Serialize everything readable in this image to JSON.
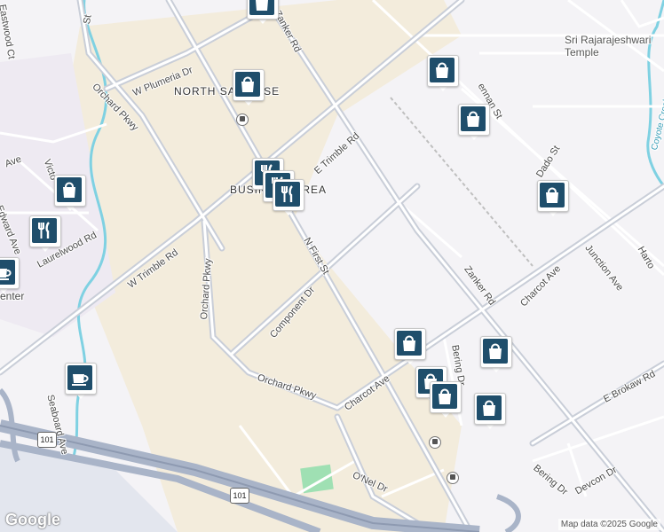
{
  "map": {
    "area_labels": [
      {
        "id": "north-san-jose",
        "text": "NORTH SAN JOSE"
      },
      {
        "id": "business-area",
        "text": "BUSINESS AREA"
      },
      {
        "id": "center",
        "text": "enter"
      }
    ],
    "street_labels": [
      {
        "id": "zanker-rd-north",
        "text": "Zanker Rd"
      },
      {
        "id": "w-plumeria-dr",
        "text": "W Plumeria Dr"
      },
      {
        "id": "orchard-pkwy-north",
        "text": "Orchard Pkwy"
      },
      {
        "id": "orchard-pkwy-west",
        "text": "Orchard Pkwy"
      },
      {
        "id": "e-trimble-rd",
        "text": "E Trimble Rd"
      },
      {
        "id": "w-trimble-rd",
        "text": "W Trimble Rd"
      },
      {
        "id": "n-first-st",
        "text": "N First St"
      },
      {
        "id": "component-dr",
        "text": "Component Dr"
      },
      {
        "id": "orchard-pkwy-south-v",
        "text": "Orchard Pkwy"
      },
      {
        "id": "orchard-pkwy-south",
        "text": "Orchard Pkwy"
      },
      {
        "id": "charcot-ave-sw",
        "text": "Charcot Ave"
      },
      {
        "id": "charcot-ave-ne",
        "text": "Charcot Ave"
      },
      {
        "id": "zanker-rd-south",
        "text": "Zanker Rd"
      },
      {
        "id": "junction-ave",
        "text": "Junction Ave"
      },
      {
        "id": "e-brokaw-rd",
        "text": "E Brokaw Rd"
      },
      {
        "id": "dado-st",
        "text": "Dado St"
      },
      {
        "id": "bering-dr-north",
        "text": "Bering Dr"
      },
      {
        "id": "bering-dr-south",
        "text": "Bering Dr"
      },
      {
        "id": "devcon-dr",
        "text": "Devcon Dr"
      },
      {
        "id": "onel-dr",
        "text": "O'Nel Dr"
      },
      {
        "id": "seaboard-ave",
        "text": "Seaboard Ave"
      },
      {
        "id": "laurelwood-rd",
        "text": "Laurelwood Rd"
      },
      {
        "id": "edward-ave",
        "text": "Edward Ave"
      },
      {
        "id": "eastwood-ct",
        "text": "Eastwood Ct"
      },
      {
        "id": "victor",
        "text": "Victo"
      },
      {
        "id": "ave-left",
        "text": "Ave"
      },
      {
        "id": "brennan-st",
        "text": "ennan St"
      },
      {
        "id": "harton",
        "text": "Harto"
      },
      {
        "id": "coyote-creek",
        "text": "Coyote Creek"
      },
      {
        "id": "hwy-101-west",
        "text": "101"
      },
      {
        "id": "hwy-101-east",
        "text": "101"
      },
      {
        "id": "orchard-north-top",
        "text": "Orchard"
      },
      {
        "id": "st-left",
        "text": "St"
      }
    ],
    "poi_labels": [
      {
        "id": "temple",
        "text": "Sri Rajarajeshwari Temple"
      }
    ],
    "pins": [
      {
        "id": "shop-top",
        "icon": "shopping-bag-icon"
      },
      {
        "id": "shop-north-sj",
        "icon": "shopping-bag-icon"
      },
      {
        "id": "shop-ne-1",
        "icon": "shopping-bag-icon"
      },
      {
        "id": "shop-ne-2",
        "icon": "shopping-bag-icon"
      },
      {
        "id": "shop-dado",
        "icon": "shopping-bag-icon"
      },
      {
        "id": "shop-left",
        "icon": "shopping-bag-icon"
      },
      {
        "id": "shop-charcot",
        "icon": "shopping-bag-icon"
      },
      {
        "id": "shop-se-1",
        "icon": "shopping-bag-icon"
      },
      {
        "id": "shop-se-2",
        "icon": "shopping-bag-icon"
      },
      {
        "id": "shop-se-3",
        "icon": "shopping-bag-icon"
      },
      {
        "id": "shop-se-4",
        "icon": "shopping-bag-icon"
      },
      {
        "id": "food-cluster-1",
        "icon": "restaurant-icon"
      },
      {
        "id": "food-cluster-2",
        "icon": "restaurant-icon"
      },
      {
        "id": "food-cluster-3",
        "icon": "restaurant-icon"
      },
      {
        "id": "food-left",
        "icon": "restaurant-icon"
      },
      {
        "id": "cafe-left",
        "icon": "coffee-icon"
      },
      {
        "id": "cafe-south",
        "icon": "coffee-icon"
      }
    ],
    "colors": {
      "background": "#f4f3f6",
      "commercial": "#f3ecdc",
      "highway": "#a9b4c8",
      "arterial": "#c9ced8",
      "water": "#7fd1e2",
      "park": "#9fe0b3",
      "pin": "#1f4e6b"
    }
  },
  "branding": {
    "logo": "Google",
    "attribution": "Map data ©2025 Google"
  }
}
